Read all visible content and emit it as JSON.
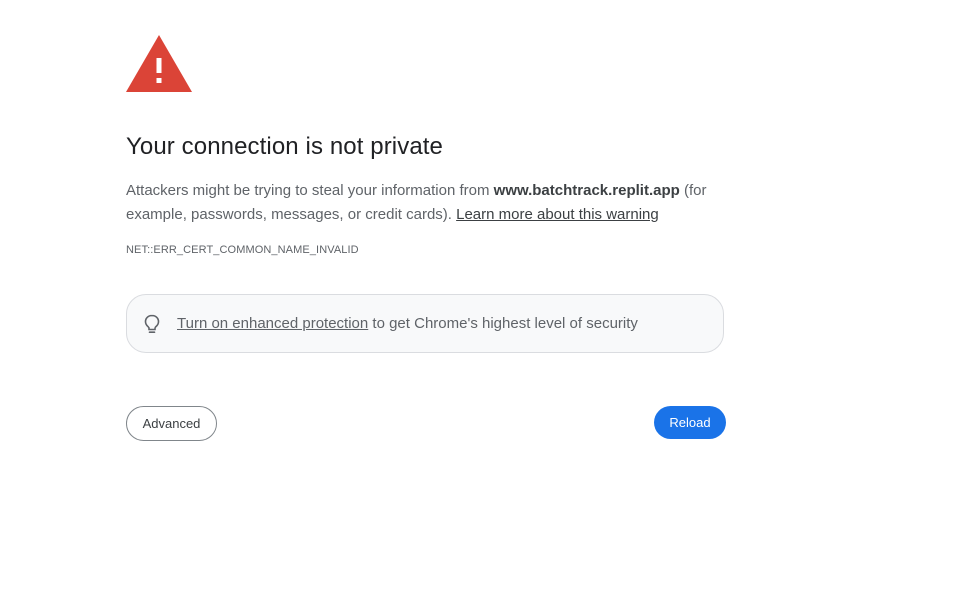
{
  "icons": {
    "warning": "warning-triangle-icon",
    "bulb": "lightbulb-icon"
  },
  "colors": {
    "warning_red": "#db4437",
    "primary_blue": "#1a73e8",
    "box_background": "#f8f9fa"
  },
  "main": {
    "title": "Your connection is not private",
    "description_prefix": "Attackers might be trying to steal your information from ",
    "domain": "www.batchtrack.replit.app",
    "description_suffix": " (for example, passwords, messages, or credit cards). ",
    "learn_more_link": "Learn more about this warning",
    "error_code": "NET::ERR_CERT_COMMON_NAME_INVALID"
  },
  "protection": {
    "link_text": "Turn on enhanced protection",
    "suffix_text": " to get Chrome's highest level of security"
  },
  "buttons": {
    "advanced": "Advanced",
    "reload": "Reload"
  }
}
